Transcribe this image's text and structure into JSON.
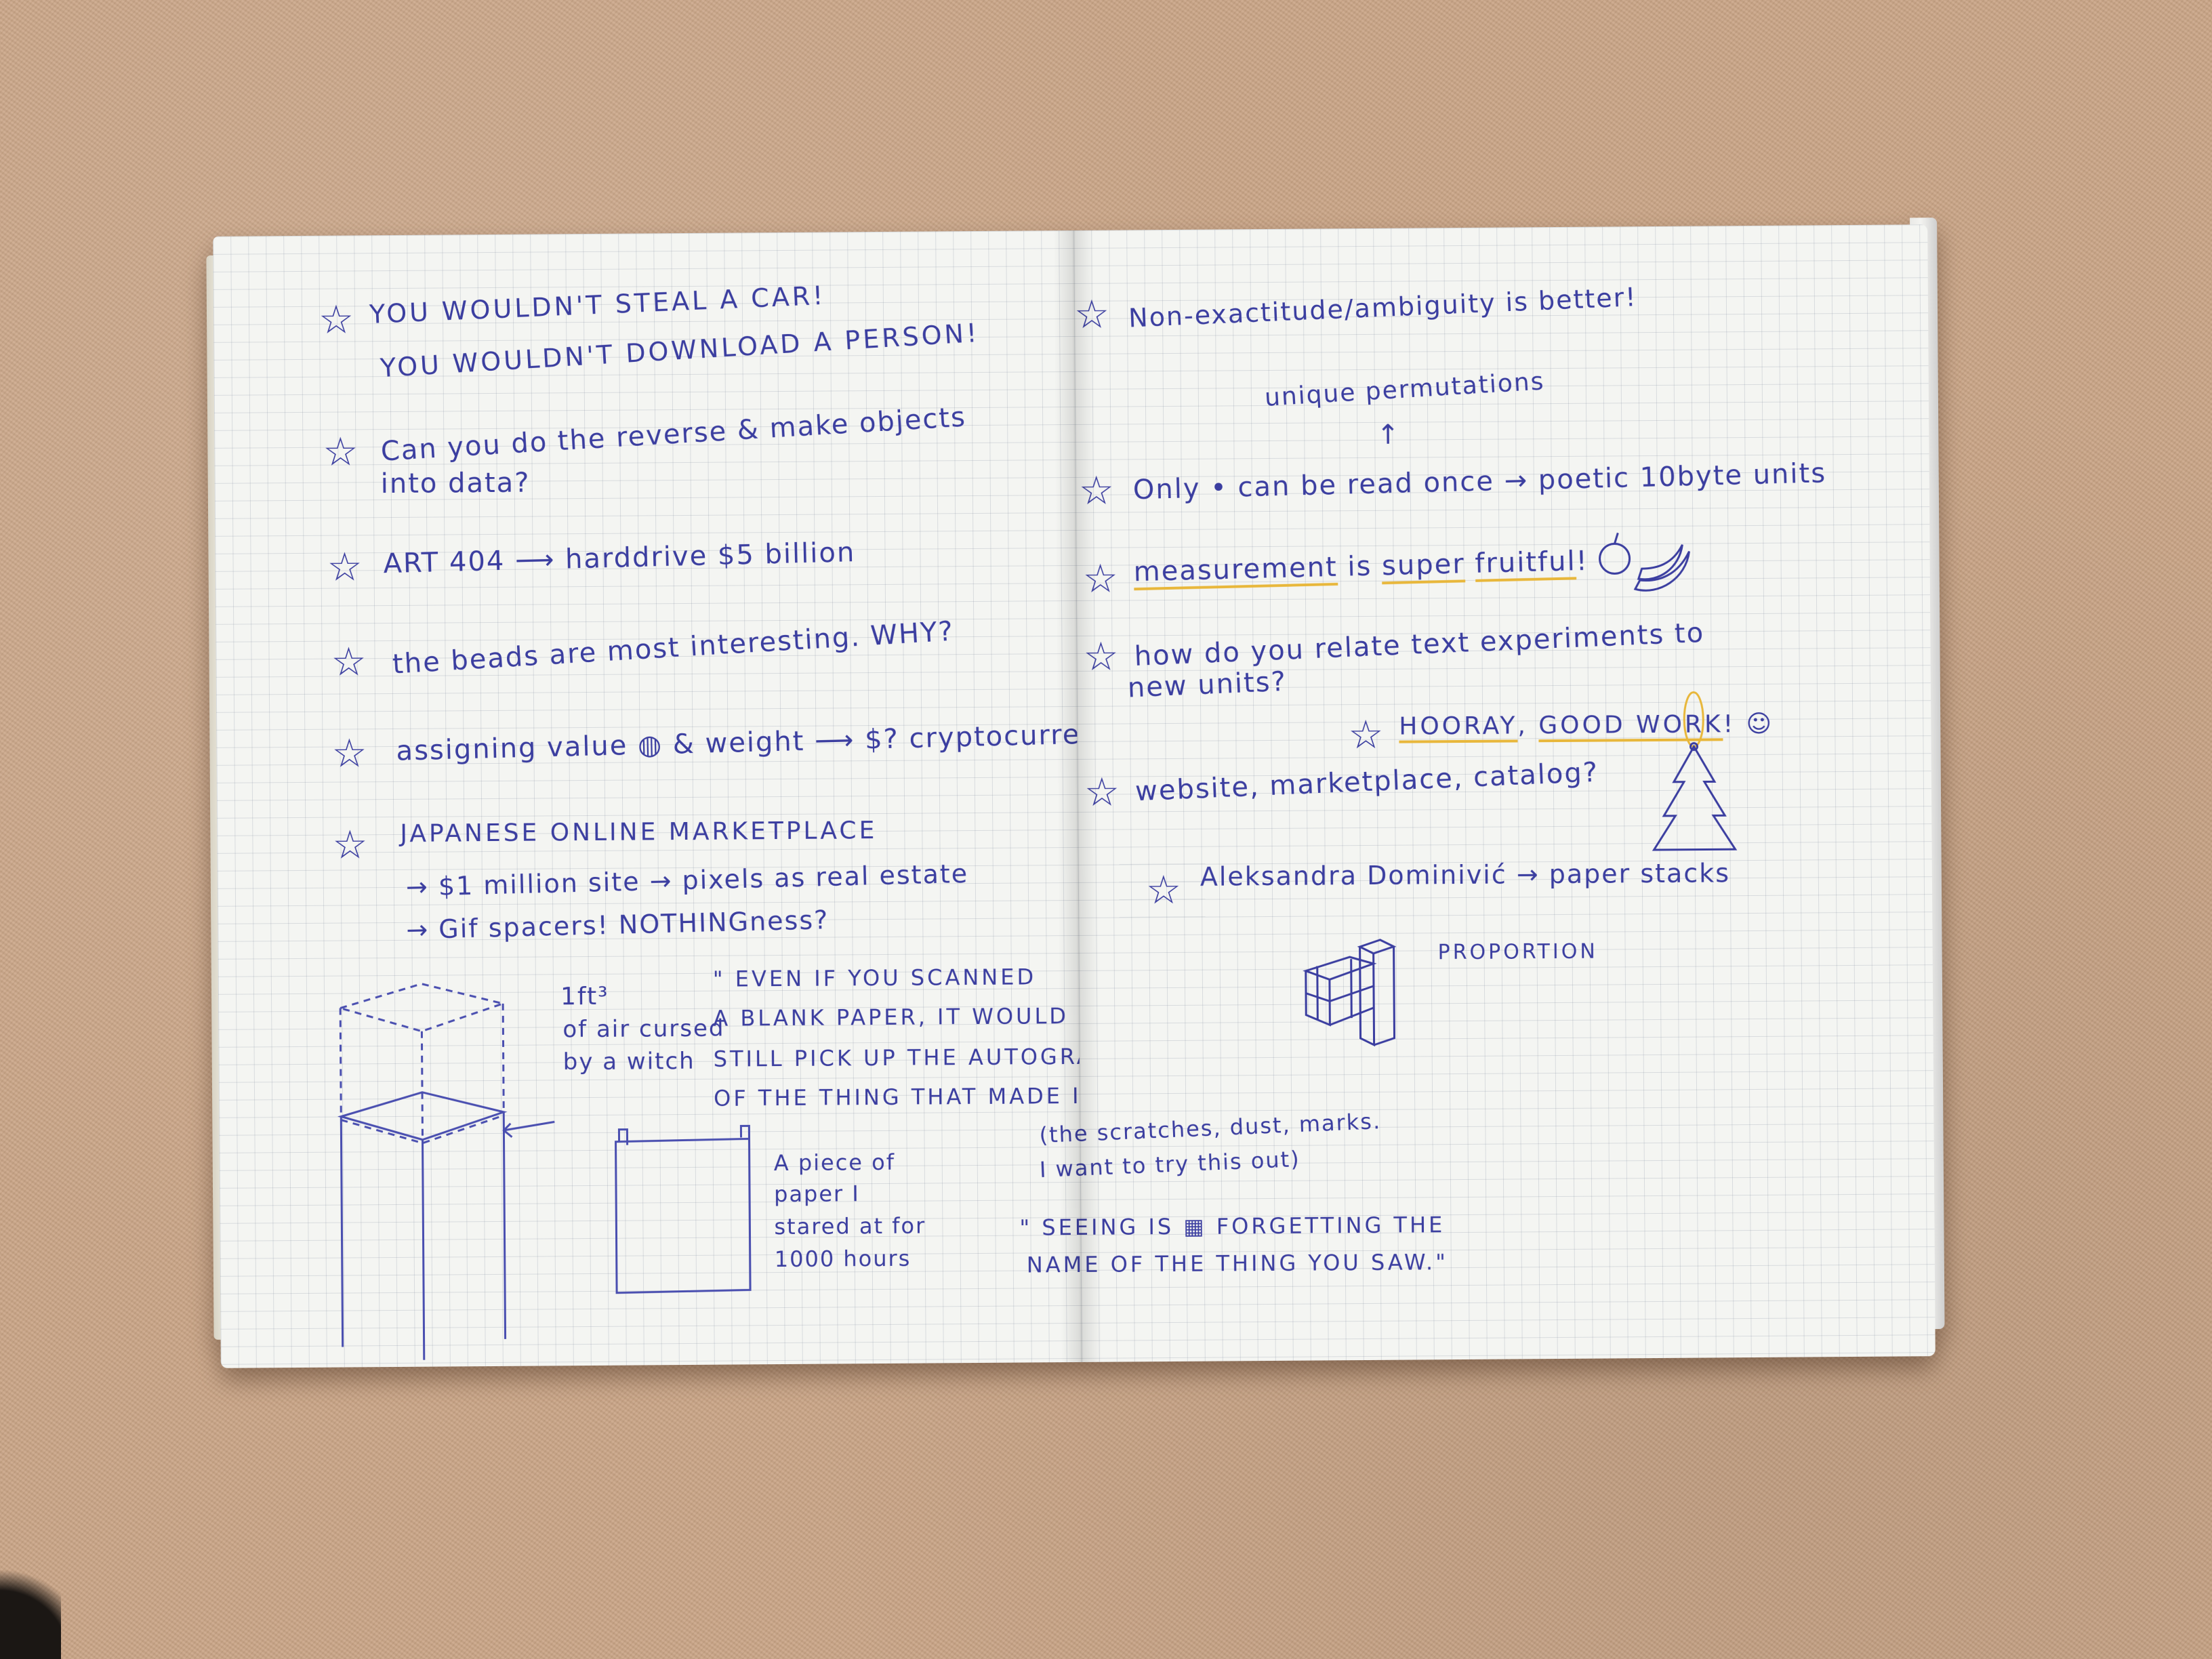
{
  "left_page": {
    "star": "☆",
    "note1_line1": "YOU WOULDN'T STEAL A CAR!",
    "note1_line2": "YOU WOULDN'T DOWNLOAD A PERSON!",
    "note2_line1": "Can you do the reverse & make objects",
    "note2_line2": "into data?",
    "note3": "ART 404 ⟶ harddrive $5 billion",
    "note4": "the beads are most interesting. WHY?",
    "note5": "assigning value ◍ & weight ⟶ $? cryptocurrency?",
    "note6_line1": "JAPANESE ONLINE MARKETPLACE",
    "note6_line2": "→ $1 million site → pixels as real estate",
    "note6_line3": "→ Gif spacers! NOTHINGness?",
    "cube_label_1": "1ft³",
    "cube_label_2": "of air cursed",
    "cube_label_3": "by a witch",
    "quote1_line1": "\" EVEN IF YOU SCANNED",
    "quote1_line2": "A BLANK PAPER, IT WOULD",
    "quote1_line3": "STILL PICK UP THE AUTOGRAPH/TRACE",
    "quote1_line4": "OF THE THING THAT MADE IT.\"",
    "paper_label_1": "A piece of",
    "paper_label_2": "paper I",
    "paper_label_3": "stared at for",
    "paper_label_4": "1000 hours"
  },
  "right_page": {
    "note1": "Non-exactitude/ambiguity is better!",
    "note2_top": "unique permutations",
    "note2_arrow": "↑",
    "note2": "Only • can be read once → poetic 10byte units",
    "note3_a": "measurement",
    "note3_b": " is ",
    "note3_c": "super",
    "note3_d": " ",
    "note3_e": "fruitful",
    "note3_f": "!",
    "note4_line1": "how do you relate text experiments to",
    "note4_line2": "new units?",
    "note5_a": "HOORAY",
    "note5_b": ", ",
    "note5_c": "GOOD WORK",
    "note5_d": "! ☺",
    "note6": "website, marketplace, catalog?",
    "note7": "Aleksandra Dominivić → paper stacks",
    "proportion": "PROPORTION",
    "paren_line1": "(the scratches, dust, marks.",
    "paren_line2": "I want to try this out)",
    "quote2_line1": "\" SEEING IS ▦ FORGETTING THE",
    "quote2_line2": "NAME OF THE THING YOU SAW.\""
  },
  "colors": {
    "ink": "#3b3ea0",
    "highlight": "#e8b73b",
    "carpet": "#c9a587",
    "paper": "#f4f5f2"
  },
  "icons": [
    "star-bullet-icon",
    "apple-icon",
    "banana-icon",
    "smiley-icon",
    "tree-ornament-icon",
    "cube-icon",
    "box-icon",
    "tall-box-icon"
  ]
}
